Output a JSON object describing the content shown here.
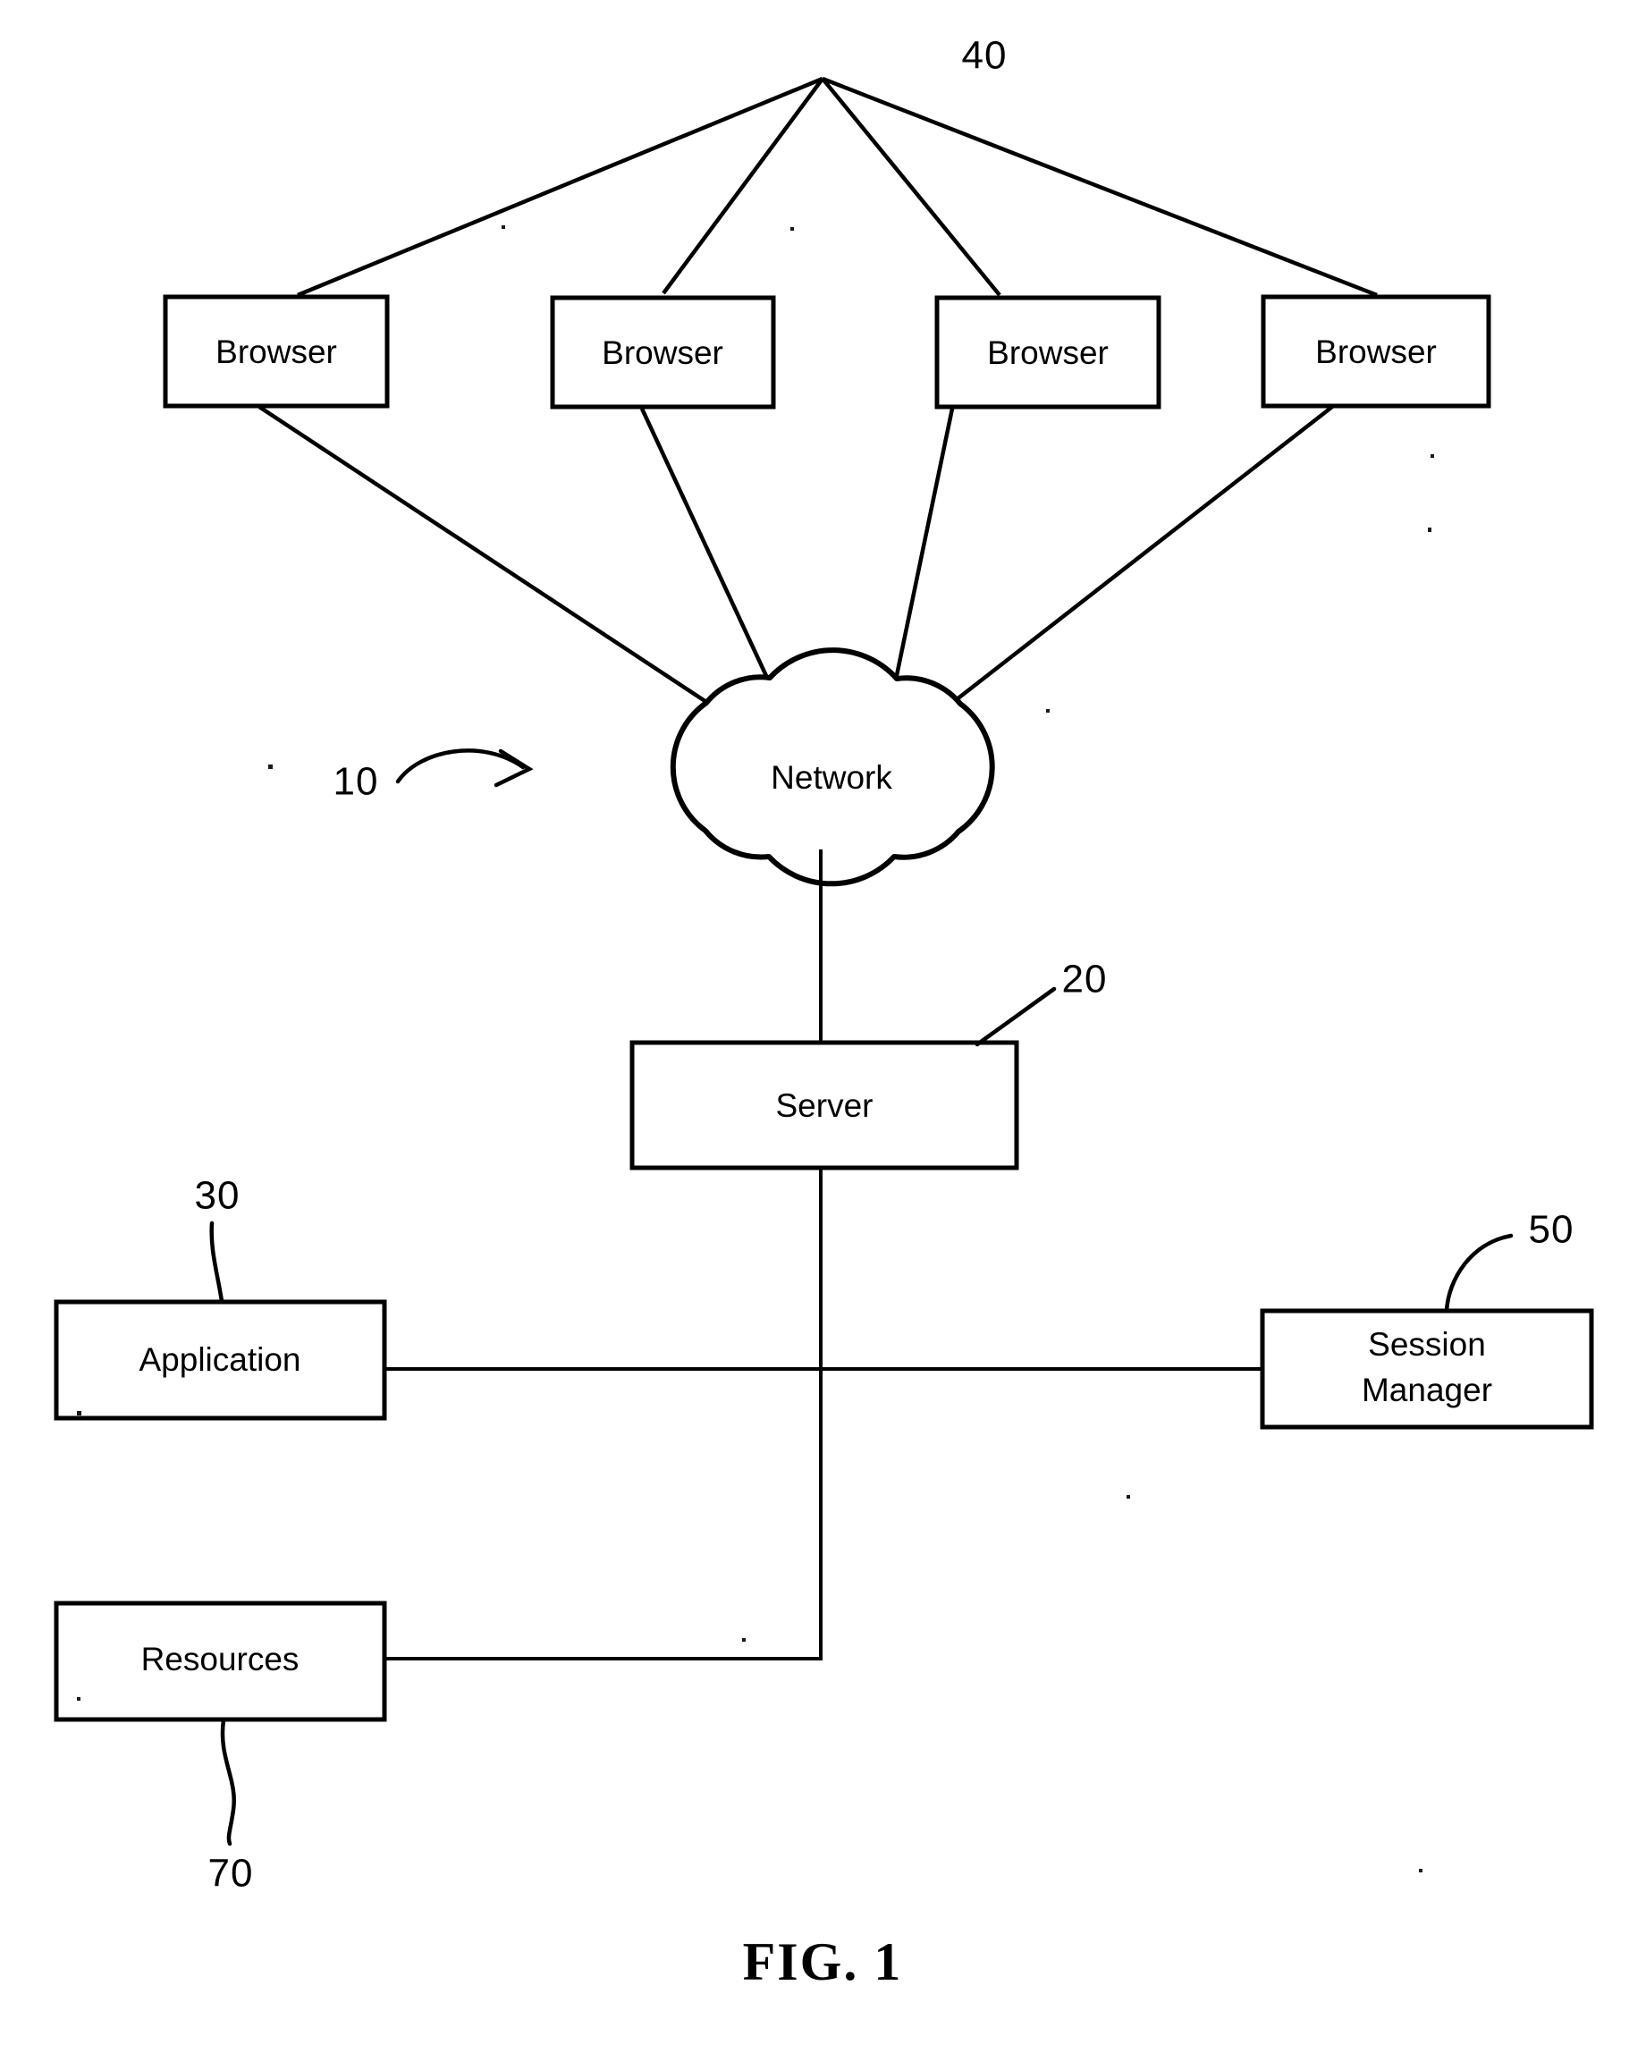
{
  "figure": {
    "caption": "FIG. 1",
    "system_ref": "10"
  },
  "nodes": {
    "browser_1": {
      "label": "Browser"
    },
    "browser_2": {
      "label": "Browser"
    },
    "browser_3": {
      "label": "Browser"
    },
    "browser_4": {
      "label": "Browser"
    },
    "network": {
      "label": "Network"
    },
    "server": {
      "label": "Server"
    },
    "application": {
      "label": "Application"
    },
    "session_manager": {
      "label_line1": "Session",
      "label_line2": "Manager"
    },
    "resources": {
      "label": "Resources"
    }
  },
  "reference_numerals": {
    "browsers_group": "40",
    "server": "20",
    "application": "30",
    "session_manager": "50",
    "resources": "70",
    "system": "10"
  },
  "colors": {
    "ink": "#000000",
    "paper": "#ffffff"
  }
}
